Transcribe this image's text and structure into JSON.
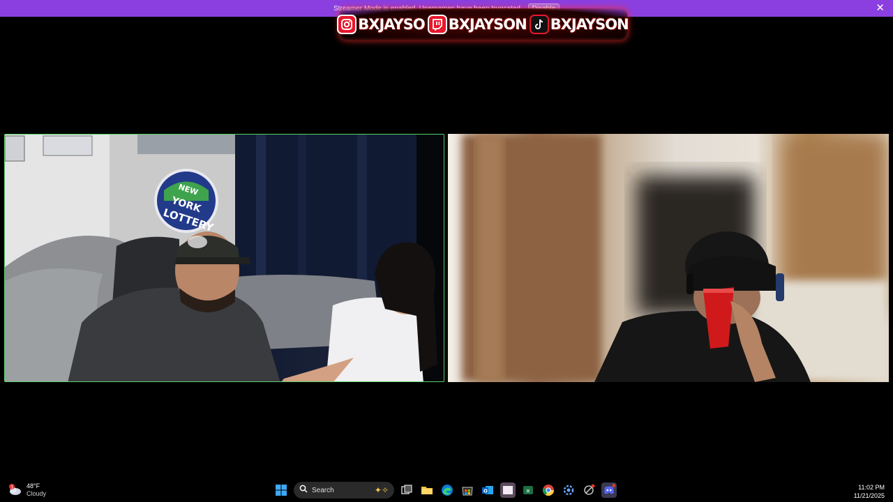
{
  "banner": {
    "message": "Streamer Mode is enabled. Usernames have been truncated.",
    "disable_label": "Disable",
    "close_glyph": "✕",
    "color": "#8b3fe0"
  },
  "social_overlay": {
    "accent": "#e8172b",
    "items": [
      {
        "icon": "instagram-icon",
        "handle": "BXJAYSO"
      },
      {
        "icon": "twitch-icon",
        "handle": "BXJAYSON"
      },
      {
        "icon": "tiktok-icon",
        "handle": "BXJAYSON"
      }
    ]
  },
  "video_tiles": {
    "left": {
      "speaking": true,
      "highlight_color": "#58d36a",
      "sign_text": [
        "NEW",
        "YORK",
        "LOTTERY"
      ]
    },
    "right": {
      "speaking": false
    }
  },
  "taskbar": {
    "weather": {
      "temp": "48°F",
      "condition": "Cloudy",
      "icon": "cloud-icon"
    },
    "search": {
      "label": "Search"
    },
    "apps": [
      {
        "name": "start-button",
        "icon": "windows-icon"
      },
      {
        "name": "task-view-button",
        "icon": "task-view-icon"
      },
      {
        "name": "file-explorer-button",
        "icon": "folder-icon"
      },
      {
        "name": "edge-button",
        "icon": "edge-icon"
      },
      {
        "name": "store-button",
        "icon": "store-icon"
      },
      {
        "name": "outlook-button",
        "icon": "outlook-icon"
      },
      {
        "name": "active-window-button",
        "icon": "window-icon"
      },
      {
        "name": "excel-button",
        "icon": "excel-icon"
      },
      {
        "name": "chrome-button",
        "icon": "chrome-icon"
      },
      {
        "name": "settings-button",
        "icon": "gear-icon"
      },
      {
        "name": "tools-button",
        "icon": "tools-icon"
      },
      {
        "name": "discord-button",
        "icon": "discord-icon"
      }
    ],
    "clock": {
      "time": "11:02 PM",
      "date": "11/21/2025"
    }
  }
}
